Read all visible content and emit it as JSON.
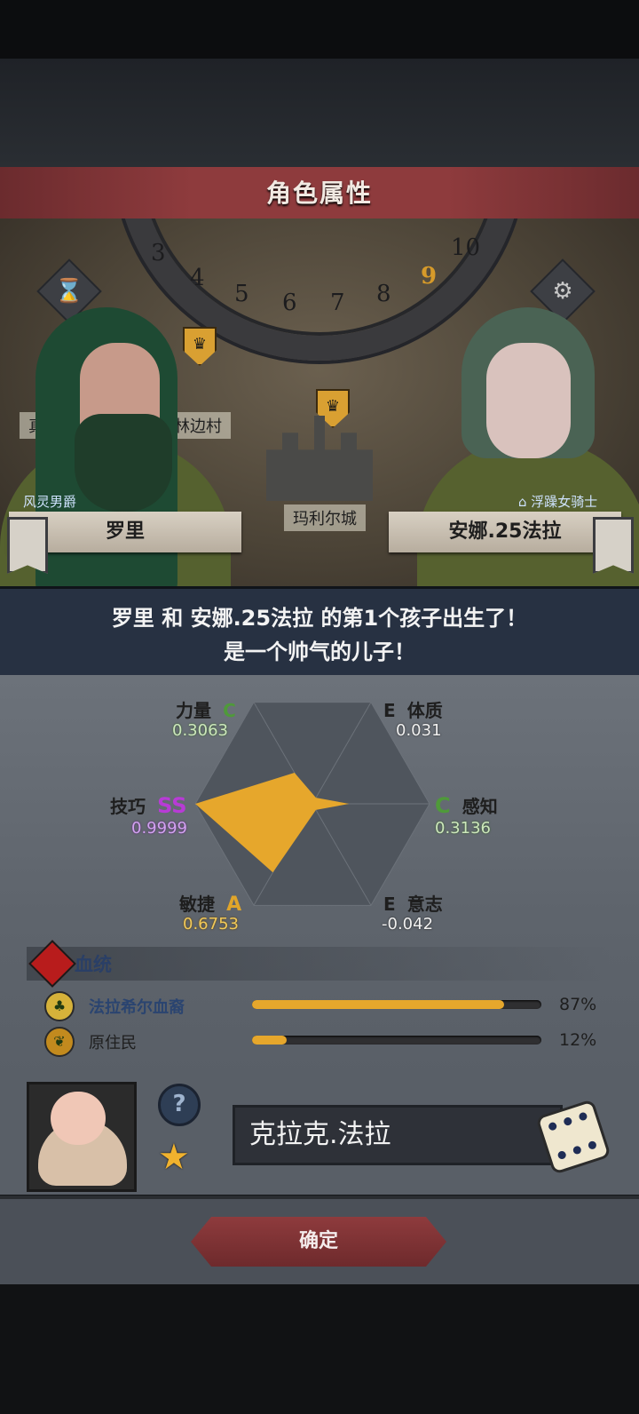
{
  "header": {
    "title": "角色属性"
  },
  "scene": {
    "dial_numbers": [
      "3",
      "4",
      "5",
      "6",
      "7",
      "8",
      "9",
      "10"
    ],
    "dial_highlight": "9",
    "places": {
      "left_partial": "真",
      "village": "林边村",
      "city": "玛利尔城"
    },
    "left_char": {
      "title": "风灵男爵",
      "name": "罗里"
    },
    "right_char": {
      "title": "浮躁女骑士",
      "name": "安娜.25法拉"
    }
  },
  "message": {
    "line1": "罗里 和 安娜.25法拉 的第1个孩子出生了！",
    "line2": "是一个帅气的儿子！"
  },
  "stats": {
    "strength": {
      "label": "力量",
      "grade": "C",
      "value": "0.3063"
    },
    "constitution": {
      "label": "体质",
      "grade": "E",
      "value": "0.031"
    },
    "skill": {
      "label": "技巧",
      "grade": "SS",
      "value": "0.9999"
    },
    "perception": {
      "label": "感知",
      "grade": "C",
      "value": "0.3136"
    },
    "agility": {
      "label": "敏捷",
      "grade": "A",
      "value": "0.6753"
    },
    "will": {
      "label": "意志",
      "grade": "E",
      "value": "-0.042"
    }
  },
  "chart_data": {
    "type": "radar",
    "axes": [
      "力量",
      "体质",
      "感知",
      "意志",
      "敏捷",
      "技巧"
    ],
    "values": [
      0.3063,
      0.031,
      0.3136,
      -0.042,
      0.6753,
      0.9999
    ],
    "range": [
      0,
      1
    ]
  },
  "bloodline": {
    "title": "血统",
    "rows": [
      {
        "label": "法拉希尔血裔",
        "percent_text": "87%",
        "fraction": 0.87
      },
      {
        "label": "原住民",
        "percent_text": "12%",
        "fraction": 0.12
      }
    ]
  },
  "child": {
    "name": "克拉克.法拉",
    "help_glyph": "?",
    "star_glyph": "★"
  },
  "confirm": {
    "label": "确定"
  },
  "colors": {
    "accent": "#e6a72c",
    "header": "#8e3b3d",
    "radar": "#e6a72c"
  }
}
